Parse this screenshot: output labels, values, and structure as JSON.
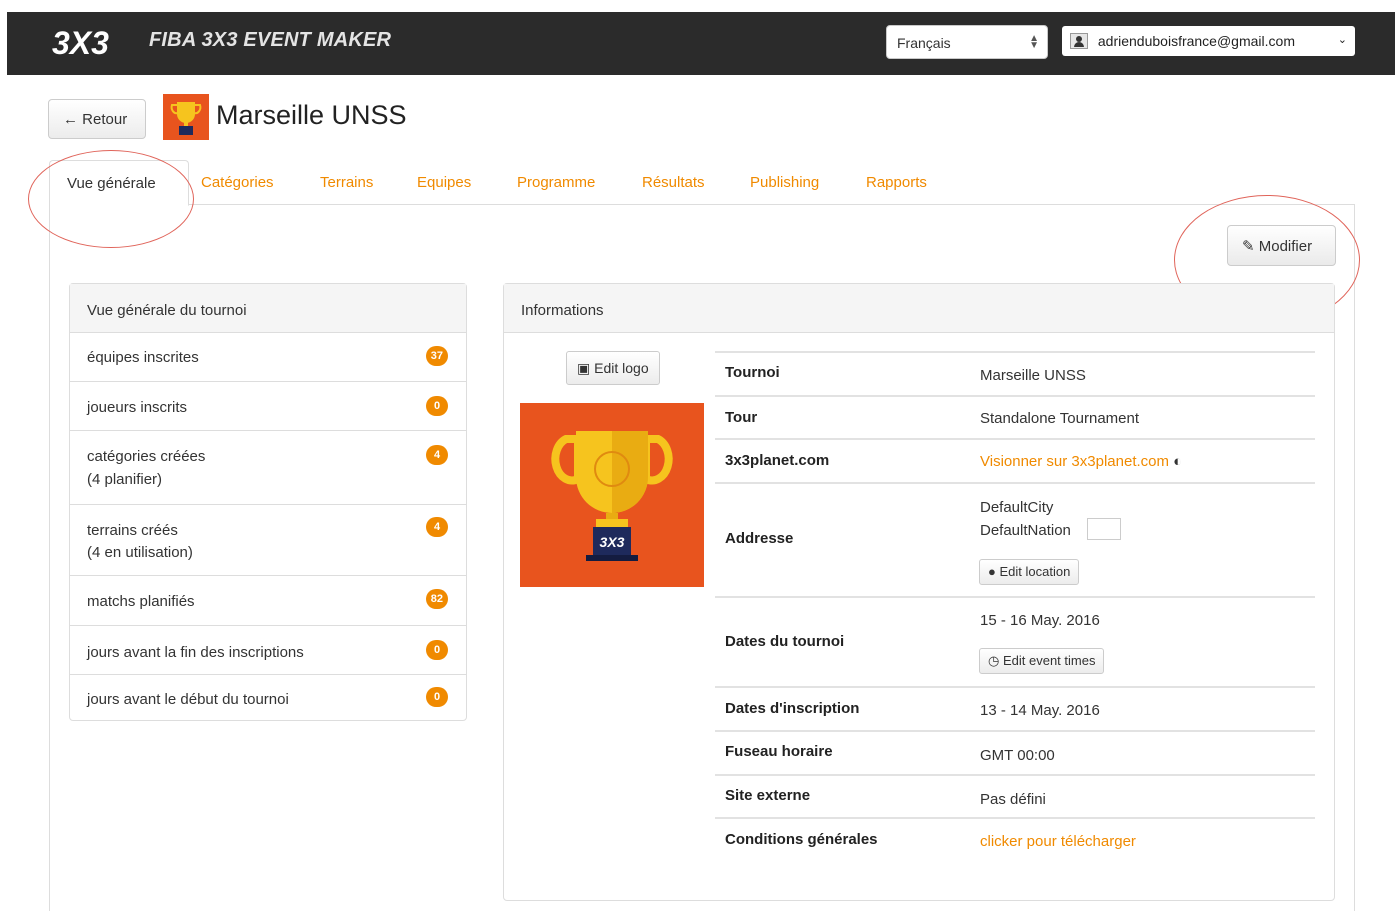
{
  "topbar": {
    "logo_text": "3X3",
    "app_title": "FIBA 3X3 EVENT MAKER",
    "language": "Français",
    "user_email": "adrienduboisfrance@gmail.com"
  },
  "header": {
    "back_label": "Retour",
    "title": "Marseille UNSS"
  },
  "tabs": [
    {
      "label": "Vue générale",
      "active": true
    },
    {
      "label": "Catégories"
    },
    {
      "label": "Terrains"
    },
    {
      "label": "Equipes"
    },
    {
      "label": "Programme"
    },
    {
      "label": "Résultats"
    },
    {
      "label": "Publishing"
    },
    {
      "label": "Rapports"
    }
  ],
  "modify_label": "Modifier",
  "overview": {
    "title": "Vue générale du tournoi",
    "items": [
      {
        "line1": "équipes inscrites",
        "line2": "",
        "count": "37"
      },
      {
        "line1": "joueurs inscrits",
        "line2": "",
        "count": "0"
      },
      {
        "line1": "catégories créées",
        "line2": "(4 planifier)",
        "count": "4"
      },
      {
        "line1": "terrains créés",
        "line2": "(4 en utilisation)",
        "count": "4"
      },
      {
        "line1": "matchs planifiés",
        "line2": "",
        "count": "82"
      },
      {
        "line1": "jours avant la fin des inscriptions",
        "line2": "",
        "count": "0"
      },
      {
        "line1": "jours avant le début du tournoi",
        "line2": "",
        "count": "0"
      }
    ]
  },
  "info": {
    "title": "Informations",
    "edit_logo": "Edit logo",
    "logo_badge": "3X3",
    "rows": {
      "tournoi": {
        "key": "Tournoi",
        "value": "Marseille UNSS"
      },
      "tour": {
        "key": "Tour",
        "value": "Standalone Tournament"
      },
      "planet": {
        "key": "3x3planet.com",
        "value": "Visionner sur 3x3planet.com"
      },
      "address": {
        "key": "Addresse",
        "city": "DefaultCity",
        "nation": "DefaultNation",
        "button": "Edit location"
      },
      "dates": {
        "key": "Dates du tournoi",
        "value": "15 - 16 May. 2016",
        "button": "Edit event times"
      },
      "registration": {
        "key": "Dates d'inscription",
        "value": "13 - 14 May. 2016"
      },
      "timezone": {
        "key": "Fuseau horaire",
        "value": "GMT 00:00"
      },
      "external": {
        "key": "Site externe",
        "value": "Pas défini"
      },
      "terms": {
        "key": "Conditions générales",
        "value": "clicker pour télécharger"
      }
    }
  },
  "colors": {
    "accent": "#f08a00",
    "topbar": "#2b2b2b",
    "logo_bg": "#e8541e",
    "annotation": "#e0645a"
  }
}
